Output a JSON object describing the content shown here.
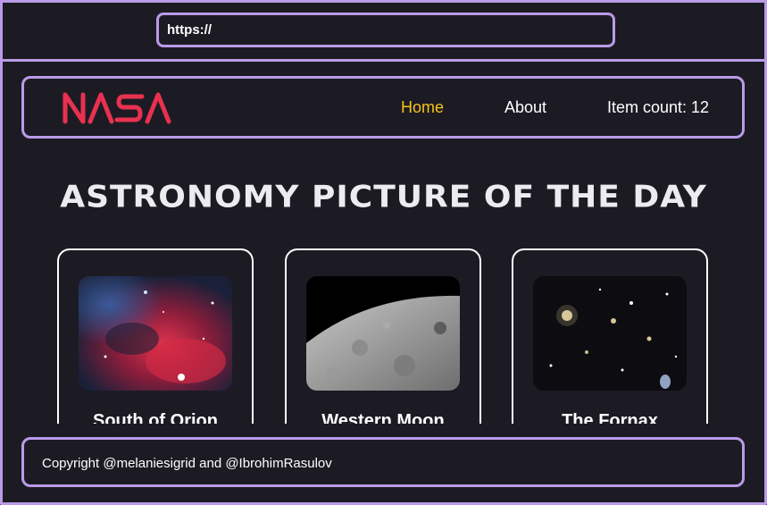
{
  "browser": {
    "url": "https://"
  },
  "nav": {
    "logo_text": "NASA",
    "links": [
      {
        "label": "Home",
        "active": true
      },
      {
        "label": "About",
        "active": false
      }
    ],
    "item_count_label": "Item count: 12"
  },
  "page_title": "Astronomy Picture of the Day",
  "cards": [
    {
      "title": "South of Orion"
    },
    {
      "title": "Western Moon"
    },
    {
      "title": "The Fornax"
    }
  ],
  "footer": {
    "text": "Copyright @melaniesigrid and @IbrohimRasulov"
  },
  "colors": {
    "accent": "#b99be8",
    "active_link": "#f5c518",
    "logo": "#e8314f",
    "background": "#1c1b24"
  }
}
